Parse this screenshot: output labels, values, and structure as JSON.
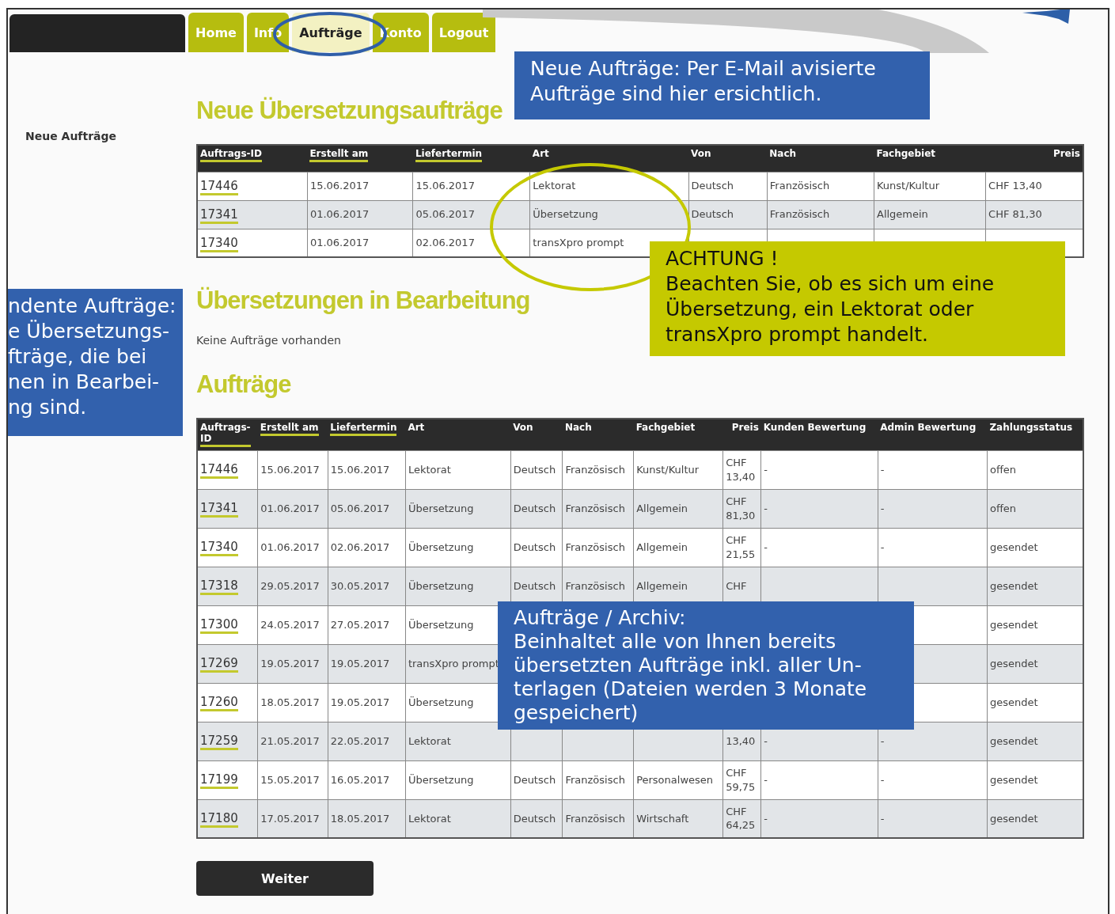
{
  "nav": {
    "tabs": [
      {
        "label": "Home",
        "selected": false
      },
      {
        "label": "Info",
        "selected": false
      },
      {
        "label": "Aufträge",
        "selected": true
      },
      {
        "label": "Konto",
        "selected": false
      },
      {
        "label": "Logout",
        "selected": false
      }
    ]
  },
  "sidebar": {
    "items": [
      {
        "label": "Neue Aufträge"
      }
    ]
  },
  "sections": [
    {
      "title": "Neue Übersetzungsaufträge",
      "table": {
        "columns": [
          {
            "label": "Auftrags-ID",
            "link": true,
            "kind": "text"
          },
          {
            "label": "Erstellt am",
            "link": true,
            "kind": "text"
          },
          {
            "label": "Liefertermin",
            "link": true,
            "kind": "text"
          },
          {
            "label": "Art",
            "link": false,
            "kind": "text"
          },
          {
            "label": "Von",
            "link": false,
            "kind": "text"
          },
          {
            "label": "Nach",
            "link": false,
            "kind": "text"
          },
          {
            "label": "Fachgebiet",
            "link": false,
            "kind": "text"
          },
          {
            "label": "Preis",
            "link": false,
            "kind": "amount"
          }
        ],
        "rows": [
          {
            "cells": [
              "17446",
              "15.06.2017",
              "15.06.2017",
              "Lektorat",
              "Deutsch",
              "Französisch",
              "Kunst/Kultur",
              "CHF 13,40"
            ]
          },
          {
            "cells": [
              "17341",
              "01.06.2017",
              "05.06.2017",
              "Übersetzung",
              "Deutsch",
              "Französisch",
              "Allgemein",
              "CHF 81,30"
            ]
          },
          {
            "cells": [
              "17340",
              "01.06.2017",
              "02.06.2017",
              "transXpro prompt",
              null,
              null,
              null,
              null
            ]
          }
        ]
      }
    },
    {
      "title": "Übersetzungen in Bearbeitung",
      "message": "Keine Aufträge vorhanden"
    },
    {
      "title": "Aufträge",
      "table": {
        "columns": [
          {
            "label": "Auftrags-\nID",
            "link": true,
            "kind": "text"
          },
          {
            "label": "Erstellt am",
            "link": true,
            "kind": "text"
          },
          {
            "label": "Liefertermin",
            "link": true,
            "kind": "text"
          },
          {
            "label": "Art",
            "link": false,
            "kind": "text"
          },
          {
            "label": "Von",
            "link": false,
            "kind": "text"
          },
          {
            "label": "Nach",
            "link": false,
            "kind": "text"
          },
          {
            "label": "Fachgebiet",
            "link": false,
            "kind": "text"
          },
          {
            "label": "Preis",
            "link": false,
            "kind": "amount"
          },
          {
            "label": "Kunden Bewertung",
            "link": false,
            "kind": "text"
          },
          {
            "label": "Admin Bewertung",
            "link": false,
            "kind": "text"
          },
          {
            "label": "Zahlungsstatus",
            "link": false,
            "kind": "text"
          }
        ],
        "rows": [
          {
            "cells": [
              "17446",
              "15.06.2017",
              "15.06.2017",
              "Lektorat",
              "Deutsch",
              "Französisch",
              "Kunst/Kultur",
              "CHF\n13,40",
              "-",
              "-",
              "offen"
            ]
          },
          {
            "cells": [
              "17341",
              "01.06.2017",
              "05.06.2017",
              "Übersetzung",
              "Deutsch",
              "Französisch",
              "Allgemein",
              "CHF\n81,30",
              "-",
              "-",
              "offen"
            ]
          },
          {
            "cells": [
              "17340",
              "01.06.2017",
              "02.06.2017",
              "Übersetzung",
              "Deutsch",
              "Französisch",
              "Allgemein",
              "CHF\n21,55",
              "-",
              "-",
              "gesendet"
            ]
          },
          {
            "cells": [
              "17318",
              "29.05.2017",
              "30.05.2017",
              "Übersetzung",
              "Deutsch",
              "Französisch",
              "Allgemein",
              "CHF",
              null,
              null,
              "gesendet"
            ]
          },
          {
            "cells": [
              "17300",
              "24.05.2017",
              "27.05.2017",
              "Übersetzung",
              null,
              null,
              null,
              null,
              null,
              null,
              "gesendet"
            ]
          },
          {
            "cells": [
              "17269",
              "19.05.2017",
              "19.05.2017",
              "transXpro prompt",
              null,
              null,
              null,
              null,
              null,
              null,
              "gesendet"
            ]
          },
          {
            "cells": [
              "17260",
              "18.05.2017",
              "19.05.2017",
              "Übersetzung",
              null,
              null,
              null,
              null,
              null,
              null,
              "gesendet"
            ]
          },
          {
            "cells": [
              "17259",
              "21.05.2017",
              "22.05.2017",
              "Lektorat",
              null,
              null,
              null,
              "13,40",
              "-",
              "-",
              "gesendet"
            ]
          },
          {
            "cells": [
              "17199",
              "15.05.2017",
              "16.05.2017",
              "Übersetzung",
              "Deutsch",
              "Französisch",
              "Personalwesen",
              "CHF\n59,75",
              "-",
              "-",
              "gesendet"
            ]
          },
          {
            "cells": [
              "17180",
              "17.05.2017",
              "18.05.2017",
              "Lektorat",
              "Deutsch",
              "Französisch",
              "Wirtschaft",
              "CHF\n64,25",
              "-",
              "-",
              "gesendet"
            ]
          }
        ]
      }
    }
  ],
  "buttons": [
    {
      "label": "Weiter"
    }
  ],
  "highlights": [
    {
      "color": "#2f5ea8"
    },
    {
      "color": "#c5c900"
    }
  ],
  "callouts": [
    {
      "color": "#3261ad",
      "lines": [
        "Neue Aufträge: Per E-Mail avisierte",
        "Aufträge sind hier ersichtlich."
      ]
    },
    {
      "color": "#c5c900",
      "lines": [
        "ACHTUNG !",
        "Beachten Sie, ob es sich um eine",
        "Übersetzung, ein Lektorat oder",
        "transXpro prompt handelt."
      ]
    },
    {
      "color": "#3261ad",
      "lines": [
        "ndente Aufträge:",
        "e Übersetzungs-",
        "fträge, die bei",
        "nen in Bearbei-",
        "ng sind."
      ]
    },
    {
      "color": "#3261ad",
      "lines": [
        "Aufträge / Archiv:",
        "Beinhaltet alle von Ihnen bereits",
        "übersetzten Aufträge inkl. aller Un-",
        "terlagen (Dateien werden 3 Monate",
        "gespeichert)"
      ]
    }
  ]
}
